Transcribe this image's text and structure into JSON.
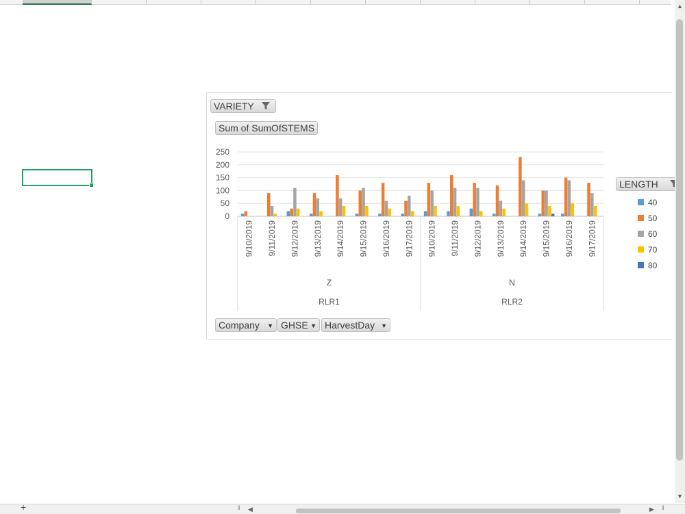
{
  "pivot": {
    "filter_field": "VARIETY",
    "value_field": "Sum of SumOfSTEMS",
    "legend_field": "LENGTH",
    "axis_fields": [
      "Company",
      "GHSE",
      "HarvestDay"
    ]
  },
  "colors": {
    "40": "#5b9bd5",
    "50": "#ed7d31",
    "60": "#a5a5a5",
    "70": "#ffc000",
    "80": "#4472c4",
    "selection": "#21a366"
  },
  "chart_data": {
    "type": "bar",
    "ylim": [
      0,
      250
    ],
    "yticks": [
      0,
      50,
      100,
      150,
      200,
      250
    ],
    "categories": [
      "9/10/2019",
      "9/11/2019",
      "9/12/2019",
      "9/13/2019",
      "9/14/2019",
      "9/15/2019",
      "9/16/2019",
      "9/17/2019",
      "9/10/2019",
      "9/11/2019",
      "9/12/2019",
      "9/13/2019",
      "9/14/2019",
      "9/15/2019",
      "9/16/2019",
      "9/17/2019"
    ],
    "group_labels": [
      {
        "label": "Z",
        "parent": "RLR1",
        "start": 0,
        "end": 7
      },
      {
        "label": "N",
        "parent": "RLR2",
        "start": 8,
        "end": 15
      }
    ],
    "series": [
      {
        "name": "40",
        "values": [
          10,
          0,
          20,
          10,
          0,
          10,
          10,
          10,
          20,
          20,
          30,
          10,
          0,
          10,
          10,
          0
        ]
      },
      {
        "name": "50",
        "values": [
          20,
          90,
          30,
          90,
          160,
          100,
          130,
          60,
          130,
          160,
          130,
          120,
          230,
          100,
          150,
          130
        ]
      },
      {
        "name": "60",
        "values": [
          0,
          40,
          110,
          70,
          70,
          110,
          60,
          80,
          100,
          110,
          110,
          60,
          140,
          100,
          140,
          90
        ]
      },
      {
        "name": "70",
        "values": [
          0,
          10,
          30,
          20,
          40,
          40,
          30,
          20,
          40,
          40,
          20,
          30,
          50,
          40,
          50,
          40
        ]
      },
      {
        "name": "80",
        "values": [
          0,
          0,
          0,
          0,
          0,
          0,
          0,
          0,
          0,
          0,
          0,
          0,
          0,
          10,
          0,
          0
        ]
      }
    ]
  }
}
